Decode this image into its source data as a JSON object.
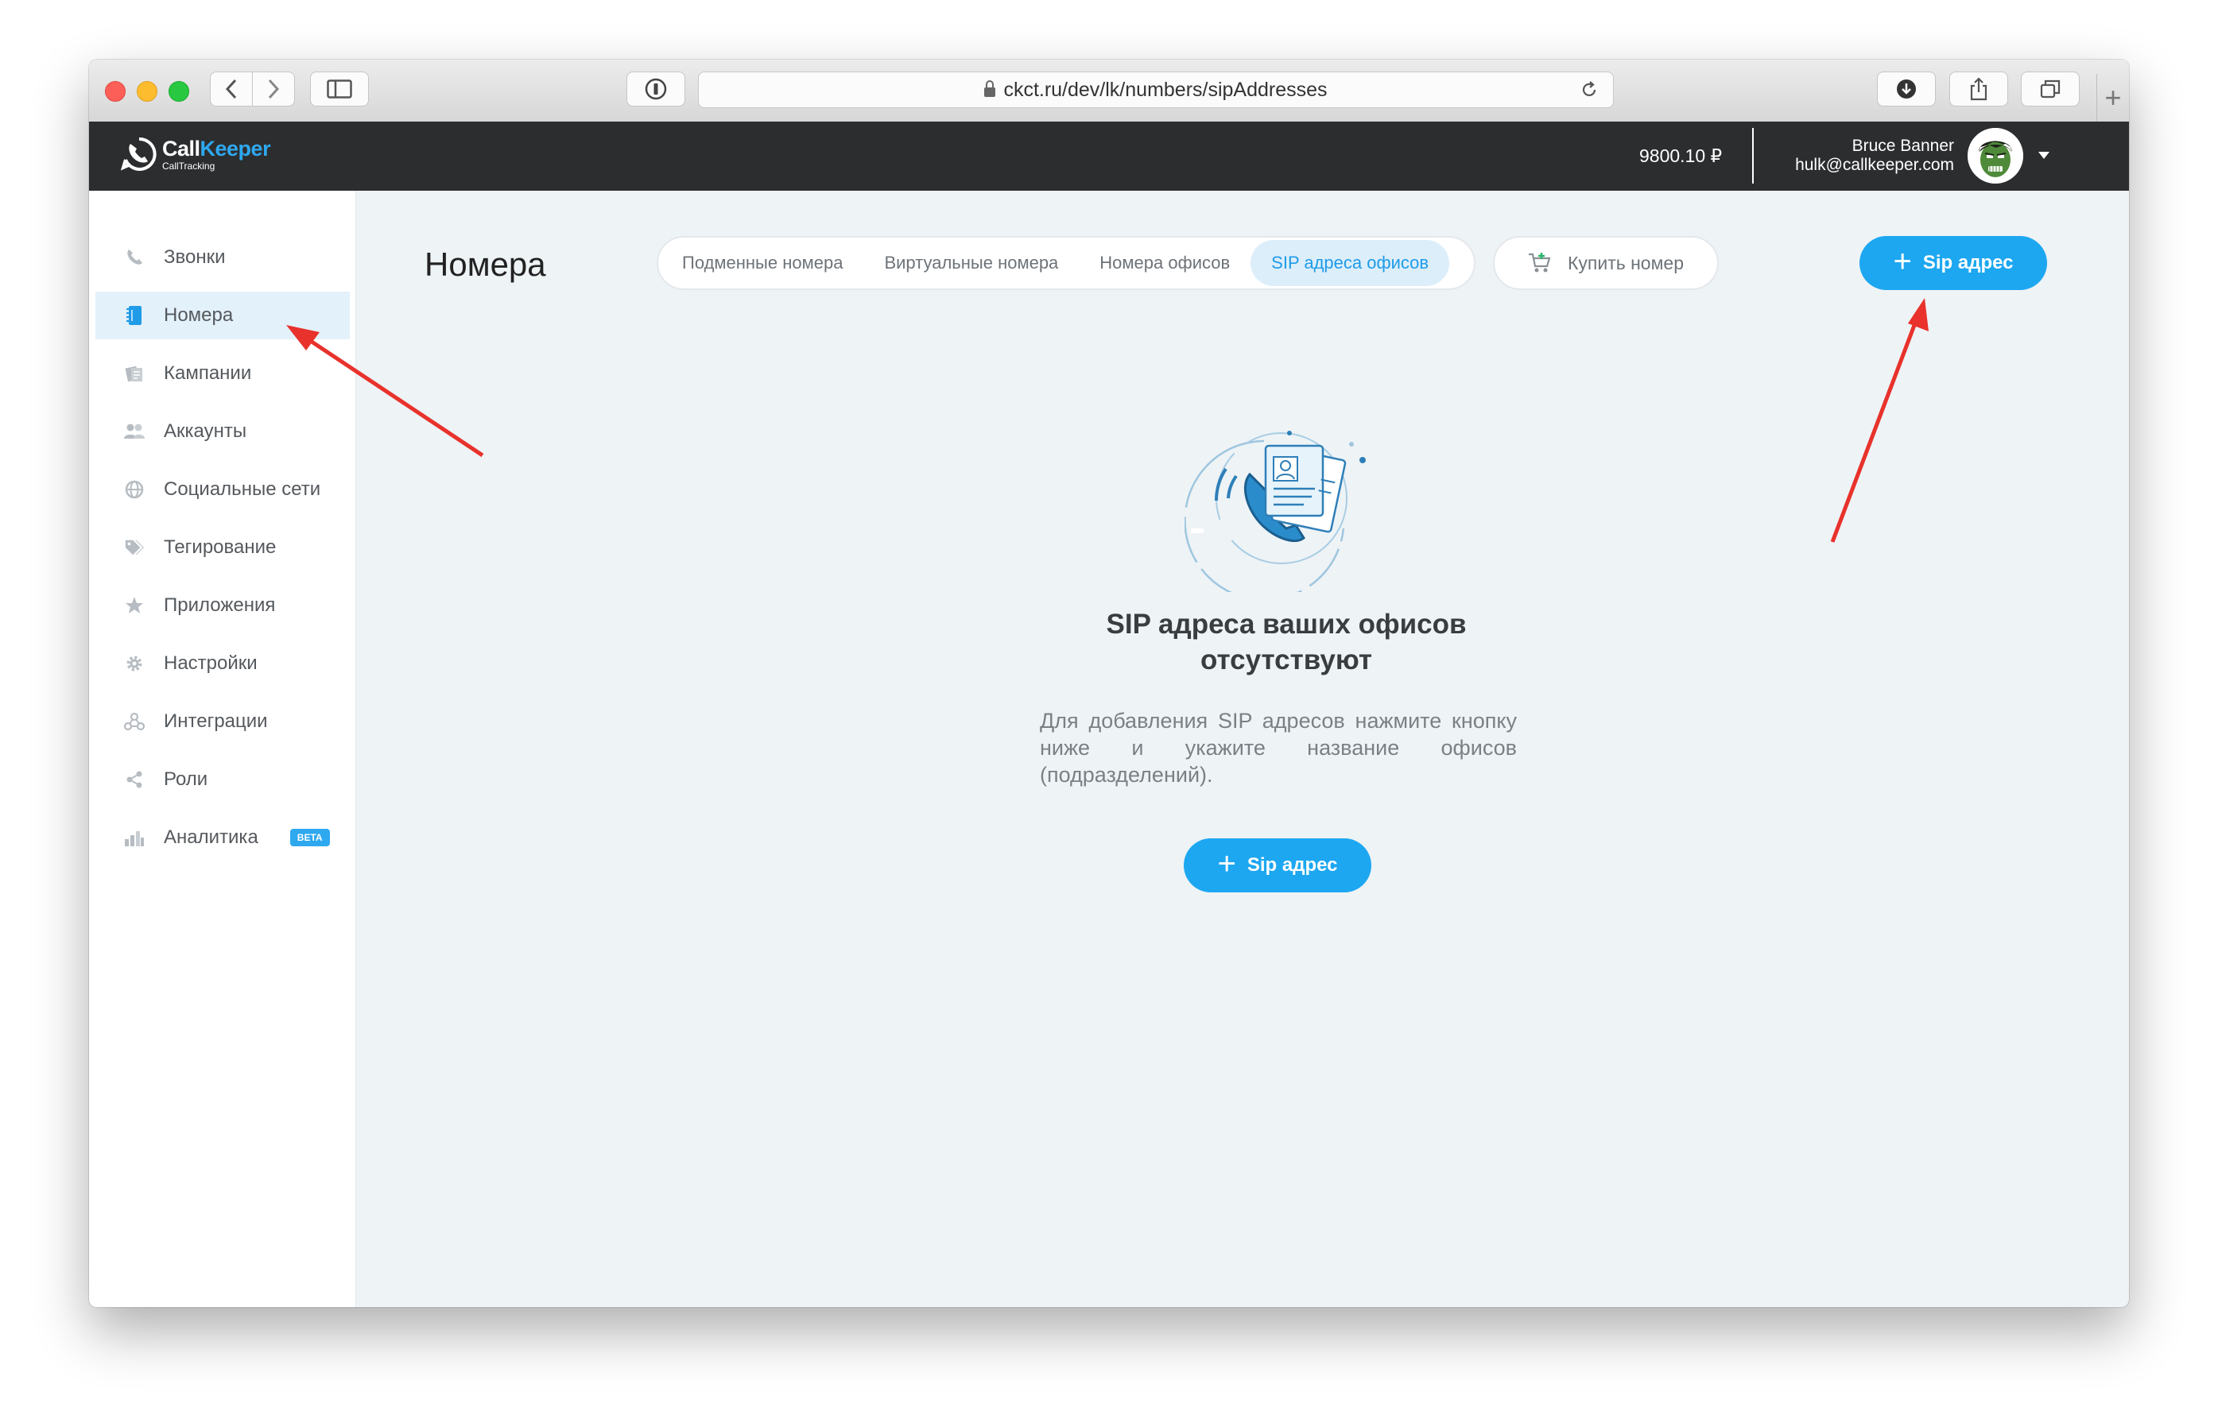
{
  "browser": {
    "url": "ckct.ru/dev/lk/numbers/sipAddresses"
  },
  "header": {
    "logo_main": "Call",
    "logo_accent": "Keeper",
    "logo_sub": "CallTracking",
    "balance": "9800.10 ₽",
    "user_name": "Bruce Banner",
    "user_email": "hulk@callkeeper.com"
  },
  "sidebar": {
    "items": [
      {
        "label": "Звонки",
        "icon": "phone-icon"
      },
      {
        "label": "Номера",
        "icon": "notebook-icon",
        "active": true
      },
      {
        "label": "Кампании",
        "icon": "documents-icon"
      },
      {
        "label": "Аккаунты",
        "icon": "users-icon"
      },
      {
        "label": "Социальные сети",
        "icon": "globe-icon"
      },
      {
        "label": "Тегирование",
        "icon": "tags-icon"
      },
      {
        "label": "Приложения",
        "icon": "star-icon"
      },
      {
        "label": "Настройки",
        "icon": "gear-icon"
      },
      {
        "label": "Интеграции",
        "icon": "integrations-icon"
      },
      {
        "label": "Роли",
        "icon": "share-icon"
      },
      {
        "label": "Аналитика",
        "icon": "bar-chart-icon",
        "badge": "BETA"
      }
    ]
  },
  "main": {
    "title": "Номера",
    "tabs": [
      {
        "label": "Подменные номера"
      },
      {
        "label": "Виртуальные номера"
      },
      {
        "label": "Номера офисов"
      },
      {
        "label": "SIP адреса офисов",
        "active": true
      }
    ],
    "buy_label": "Купить номер",
    "add_button_label": "Sip адрес",
    "empty_title_line1": "SIP адреса ваших офисов",
    "empty_title_line2": "отсутствуют",
    "empty_desc": "Для добавления SIP адресов нажмите кнопку ниже и укажите название офисов (подразделений).",
    "empty_button_label": "Sip адрес"
  },
  "colors": {
    "accent": "#1da7f1",
    "header_bg": "#2c2d2f",
    "annotation_arrow": "#e8322b"
  }
}
